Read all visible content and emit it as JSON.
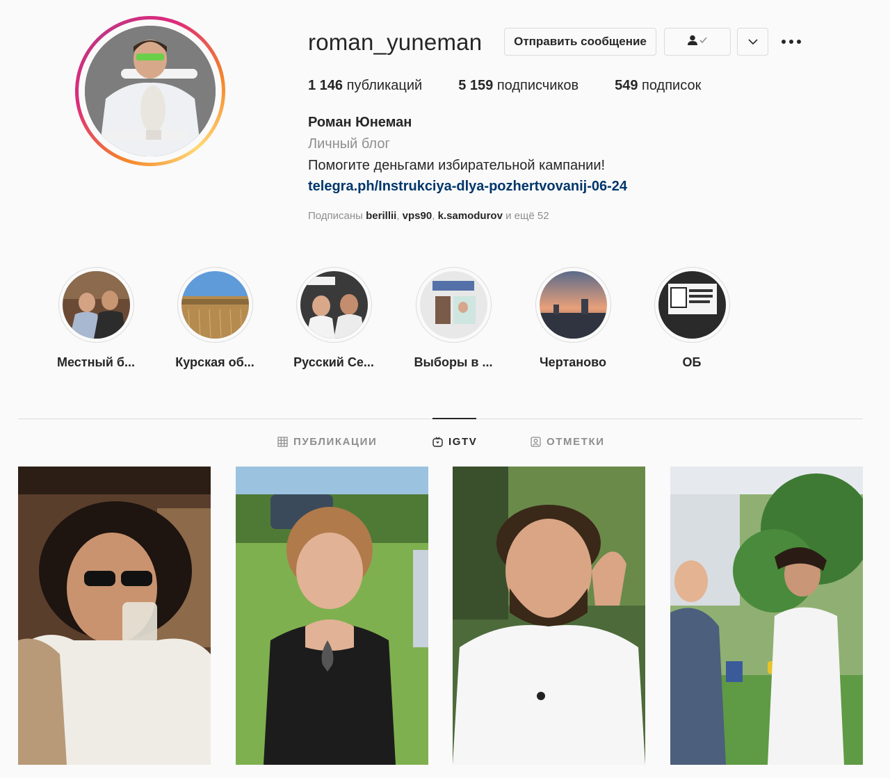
{
  "profile": {
    "username": "roman_yuneman",
    "message_button": "Отправить сообщение",
    "follow_status_icon": "person-check-icon",
    "more_icon": "chevron-down-icon",
    "options_icon": "ellipsis-icon",
    "stats": {
      "posts_count": "1 146",
      "posts_label": "публикаций",
      "followers_count": "5 159",
      "followers_label": "подписчиков",
      "following_count": "549",
      "following_label": "подписок"
    },
    "full_name": "Роман Юнеман",
    "category": "Личный блог",
    "bio": "Помогите деньгами избирательной кампании!",
    "link": "telegra.ph/Instrukciya-dlya-pozhertvovanij-06-24",
    "followed_by": {
      "prefix": "Подписаны",
      "users": [
        "berillii",
        "vps90",
        "k.samodurov"
      ],
      "suffix": "и ещё 52"
    }
  },
  "highlights": [
    {
      "label": "Местный б..."
    },
    {
      "label": "Курская об..."
    },
    {
      "label": "Русский Се..."
    },
    {
      "label": "Выборы в ..."
    },
    {
      "label": "Чертаново"
    },
    {
      "label": "ОБ"
    }
  ],
  "tabs": [
    {
      "label": "ПУБЛИКАЦИИ",
      "icon": "grid-icon",
      "active": false
    },
    {
      "label": "IGTV",
      "icon": "igtv-icon",
      "active": true
    },
    {
      "label": "ОТМЕТКИ",
      "icon": "tagged-icon",
      "active": false
    }
  ],
  "colors": {
    "background": "#fafafa",
    "text": "#262626",
    "secondary_text": "#8e8e8e",
    "link": "#00376b",
    "border": "#dbdbdb"
  }
}
